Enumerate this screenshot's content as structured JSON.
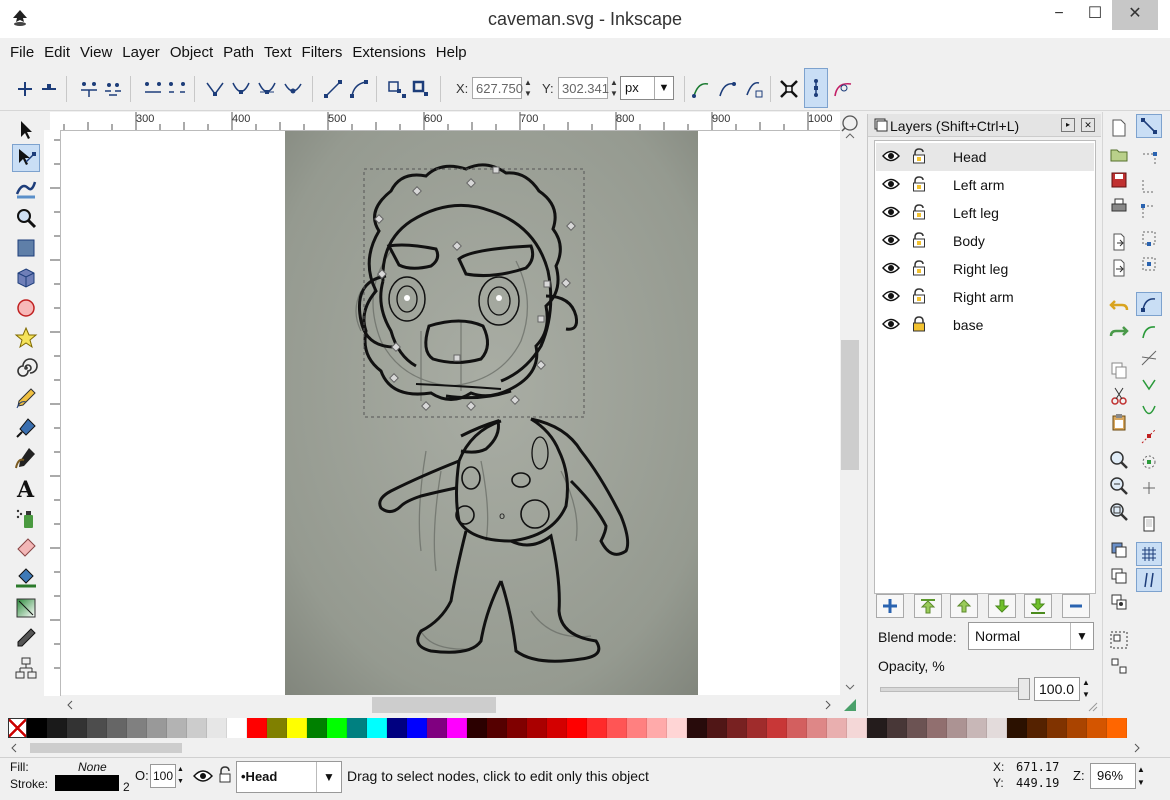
{
  "window": {
    "title": "caveman.svg - Inkscape",
    "minimize": "−",
    "maximize": "☐",
    "close": "✕"
  },
  "menu": [
    "File",
    "Edit",
    "View",
    "Layer",
    "Object",
    "Path",
    "Text",
    "Filters",
    "Extensions",
    "Help"
  ],
  "toolctrl": {
    "x_label": "X:",
    "x_value": "627.750",
    "y_label": "Y:",
    "y_value": "302.341",
    "unit": "px"
  },
  "ruler": {
    "h_ticks": [
      "300",
      "400",
      "500",
      "600",
      "700",
      "800",
      "900",
      "1000"
    ]
  },
  "layers": {
    "header": "Layers (Shift+Ctrl+L)",
    "items": [
      {
        "name": "Head",
        "selected": true,
        "locked": false
      },
      {
        "name": "Left arm",
        "selected": false,
        "locked": false
      },
      {
        "name": "Left leg",
        "selected": false,
        "locked": false
      },
      {
        "name": "Body",
        "selected": false,
        "locked": false
      },
      {
        "name": "Right leg",
        "selected": false,
        "locked": false
      },
      {
        "name": "Right arm",
        "selected": false,
        "locked": false
      },
      {
        "name": "base",
        "selected": false,
        "locked": true
      }
    ],
    "blend_label": "Blend mode:",
    "blend_value": "Normal",
    "opacity_label": "Opacity, %",
    "opacity_value": "100.0"
  },
  "palette": [
    "#000000",
    "#1a1a1a",
    "#333333",
    "#4d4d4d",
    "#666666",
    "#808080",
    "#999999",
    "#b3b3b3",
    "#cccccc",
    "#e6e6e6",
    "#ffffff",
    "#ff0000",
    "#808000",
    "#ffff00",
    "#008000",
    "#00ff00",
    "#008080",
    "#00ffff",
    "#000080",
    "#0000ff",
    "#800080",
    "#ff00ff",
    "#2b0000",
    "#550000",
    "#800000",
    "#aa0000",
    "#d40000",
    "#ff0000",
    "#ff2a2a",
    "#ff5555",
    "#ff8080",
    "#ffaaaa",
    "#ffd5d5",
    "#280b0b",
    "#501616",
    "#782121",
    "#a02c2c",
    "#c83737",
    "#d35f5f",
    "#de8787",
    "#e9afaf",
    "#f4d7d7",
    "#241c1c",
    "#483737",
    "#6c5353",
    "#916f6f",
    "#ac9393",
    "#c8b7b7",
    "#e3dbdb",
    "#2b1100",
    "#552200",
    "#803300",
    "#aa4400",
    "#d45500",
    "#ff6600"
  ],
  "status": {
    "fill_label": "Fill:",
    "fill_value": "None",
    "stroke_label": "Stroke:",
    "stroke_width": "2",
    "opacity_label": "O:",
    "opacity_value": "100",
    "layer_value": "•Head",
    "message": "Drag to select nodes, click to edit only this object",
    "cursor_x_label": "X:",
    "cursor_x": "671.17",
    "cursor_y_label": "Y:",
    "cursor_y": "449.19",
    "zoom_label": "Z:",
    "zoom_value": "96%"
  }
}
